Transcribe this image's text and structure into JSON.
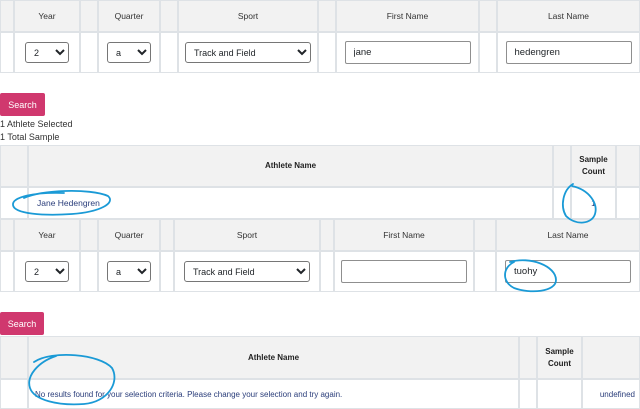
{
  "filter_form_1": {
    "headers": [
      "Year",
      "Quarter",
      "Sport",
      "First Name",
      "Last Name"
    ],
    "year_value": "2",
    "quarter_value": "a",
    "sport_value": "Track and Field",
    "first_name_value": "jane",
    "last_name_value": "hedengren"
  },
  "search_button_1": "Search",
  "summary": {
    "athletes_selected": "1 Athlete Selected",
    "total_sample": "1 Total Sample"
  },
  "results_1": {
    "col_athlete": "Athlete Name",
    "col_sample_count": "Sample Count",
    "rows": [
      {
        "athlete": "Jane Hedengren",
        "count": "1"
      }
    ]
  },
  "filter_form_2": {
    "headers": [
      "Year",
      "Quarter",
      "Sport",
      "First Name",
      "Last Name"
    ],
    "year_value": "2",
    "quarter_value": "a",
    "sport_value": "Track and Field",
    "first_name_value": "",
    "last_name_value": "tuohy"
  },
  "search_button_2": "Search",
  "results_2": {
    "col_athlete": "Athlete Name",
    "col_sample_count": "Sample Count",
    "no_results": "No results found for your selection criteria. Please change your selection and try again.",
    "extra_cell": "undefined"
  },
  "colors": {
    "accent": "#d0386e",
    "annotation": "#1a9ad6",
    "link": "#2a3d7a"
  }
}
